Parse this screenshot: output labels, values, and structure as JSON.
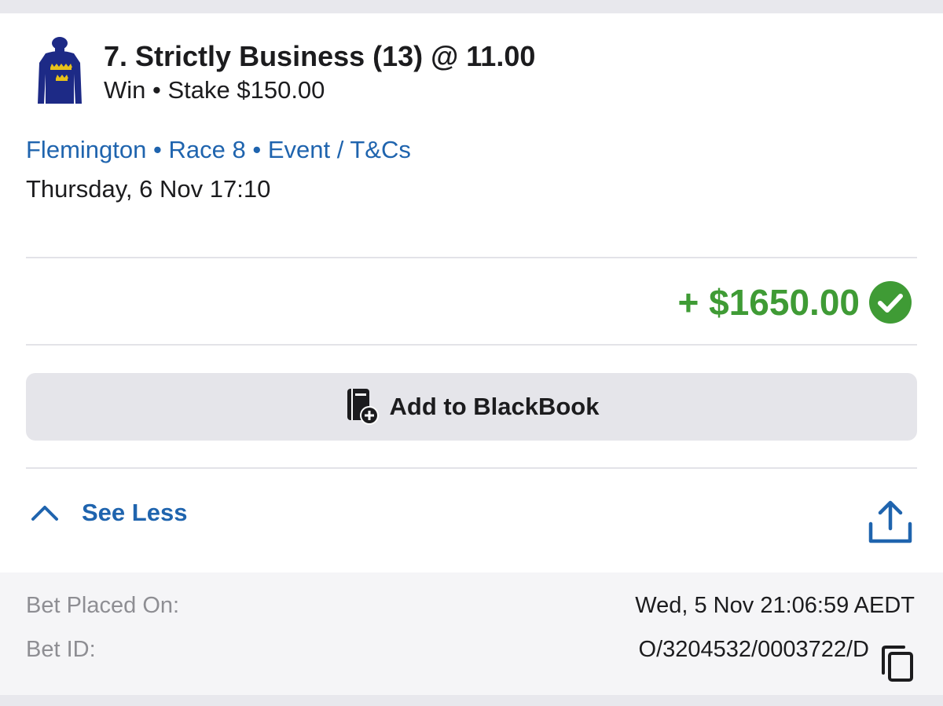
{
  "bet": {
    "title": "7. Strictly Business (13) @ 11.00",
    "subtitle": "Win • Stake $150.00",
    "silks_icon": "jockey-silks-navy-gold-crowns",
    "venue": "Flemington",
    "race": "Race 8",
    "event_link": "Event / T&Cs",
    "separator": "•",
    "race_time": "Thursday, 6 Nov 17:10",
    "payout": "+ $1650.00",
    "payout_color": "#3f9b35",
    "status_icon": "check-circle-icon"
  },
  "actions": {
    "blackbook_label": "Add to BlackBook",
    "blackbook_icon": "blackbook-add-icon",
    "see_less_label": "See Less",
    "share_icon": "share-icon"
  },
  "details": {
    "placed_label": "Bet Placed On:",
    "placed_value": "Wed, 5 Nov 21:06:59 AEDT",
    "id_label": "Bet ID:",
    "id_value": "O/3204532/0003722/D",
    "copy_icon": "copy-icon"
  },
  "colors": {
    "accent": "#1f64ae",
    "success": "#3f9b35",
    "button_bg": "#e5e5ea",
    "details_bg": "#f5f5f7"
  }
}
